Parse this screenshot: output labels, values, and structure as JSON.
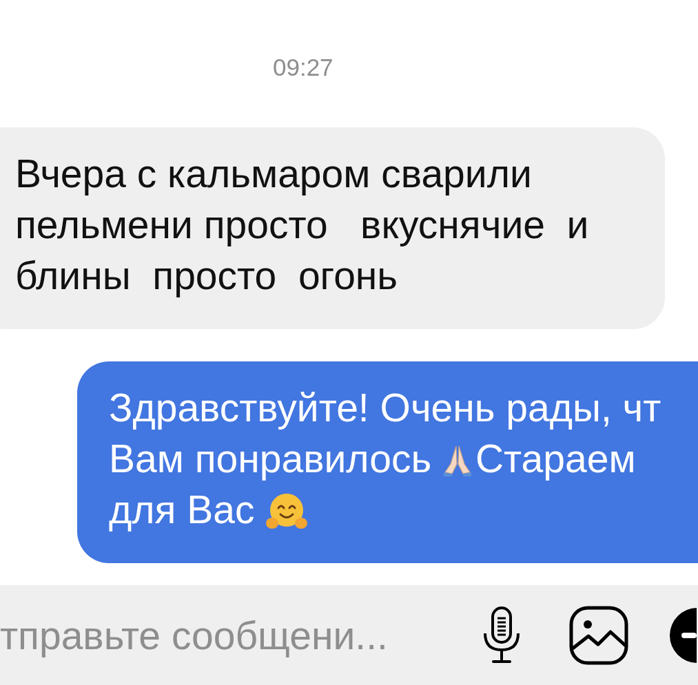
{
  "timestamp": "09:27",
  "messages": [
    {
      "kind": "incoming",
      "lines": [
        [
          {
            "kind": "text",
            "text": "Вчера с кальмаром сварили"
          }
        ],
        [
          {
            "kind": "text",
            "text": "пельмени просто   вкуснячие  и"
          }
        ],
        [
          {
            "kind": "text",
            "text": "блины  просто  огонь"
          }
        ]
      ]
    },
    {
      "kind": "outgoing",
      "lines": [
        [
          {
            "kind": "text",
            "text": "Здравствуйте! Очень рады, чт"
          }
        ],
        [
          {
            "kind": "text",
            "text": "Вам понравилось "
          },
          {
            "kind": "pray"
          },
          {
            "kind": "text",
            "text": "Стараем"
          }
        ],
        [
          {
            "kind": "text",
            "text": "для Вас "
          },
          {
            "kind": "hug"
          }
        ]
      ]
    }
  ],
  "composer": {
    "placeholder": "тправьте сообщени..."
  }
}
